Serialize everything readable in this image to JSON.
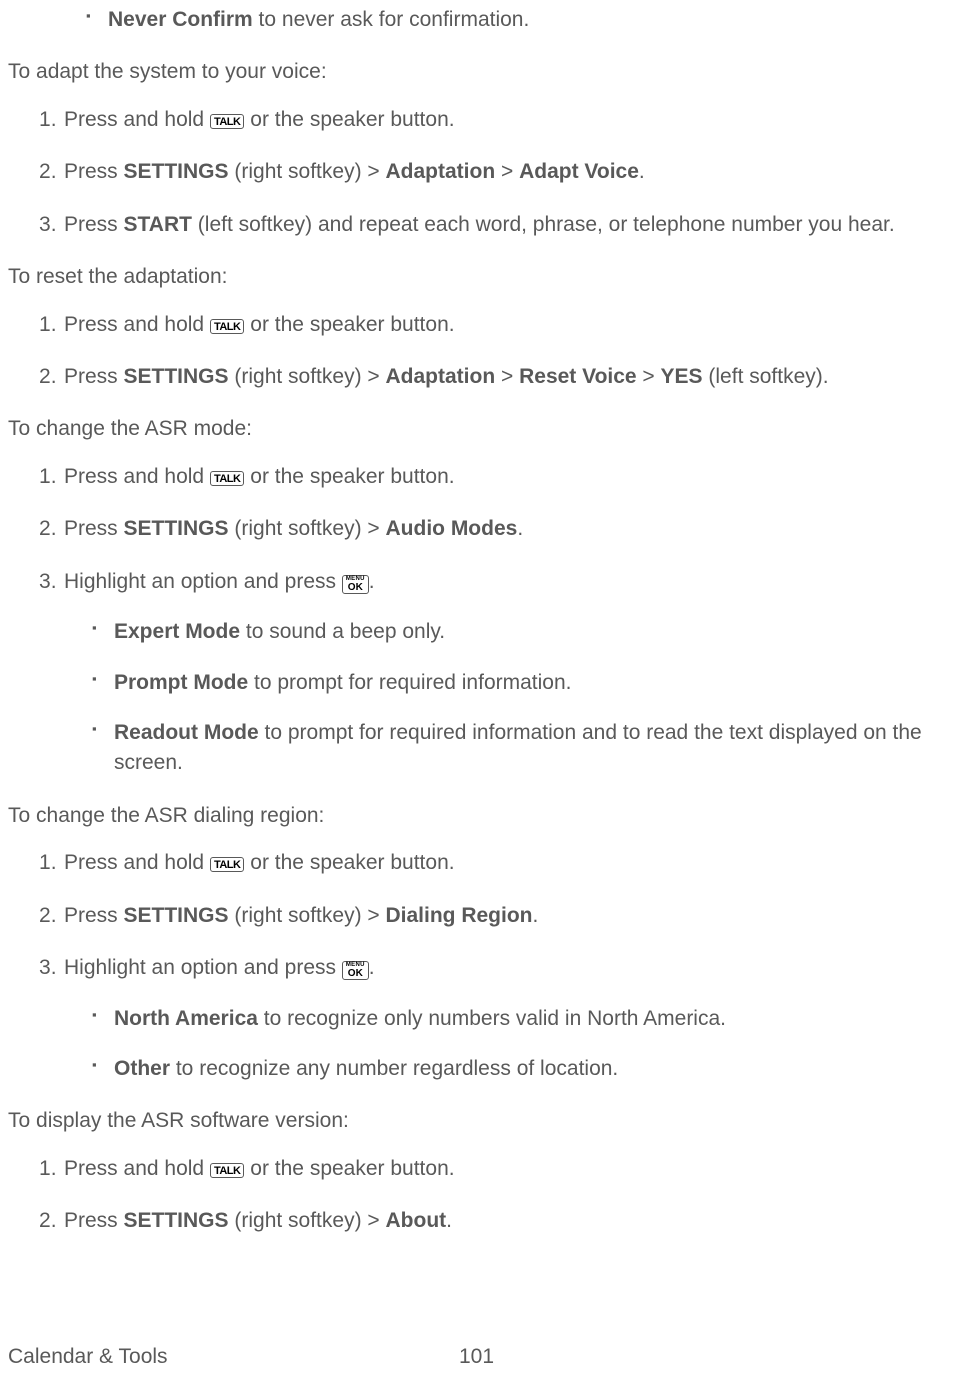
{
  "top_bullet": {
    "bold": "Never Confirm",
    "rest": " to never ask for confirmation."
  },
  "sections": [
    {
      "intro": "To adapt the system to your voice:",
      "steps": [
        {
          "prefix": "Press and hold ",
          "key": "TALK",
          "suffix": " or the speaker button."
        },
        {
          "parts": [
            {
              "t": "Press "
            },
            {
              "b": "SETTINGS"
            },
            {
              "t": " (right softkey) > "
            },
            {
              "b": "Adaptation"
            },
            {
              "t": " > "
            },
            {
              "b": "Adapt Voice"
            },
            {
              "t": "."
            }
          ]
        },
        {
          "parts": [
            {
              "t": "Press "
            },
            {
              "b": "START"
            },
            {
              "t": " (left softkey) and repeat each word, phrase, or telephone number you hear."
            }
          ]
        }
      ]
    },
    {
      "intro": "To reset the adaptation:",
      "steps": [
        {
          "prefix": "Press and hold ",
          "key": "TALK",
          "suffix": " or the speaker button."
        },
        {
          "parts": [
            {
              "t": "Press "
            },
            {
              "b": "SETTINGS"
            },
            {
              "t": " (right softkey) > "
            },
            {
              "b": "Adaptation"
            },
            {
              "t": " > "
            },
            {
              "b": "Reset Voice"
            },
            {
              "t": " > "
            },
            {
              "b": "YES"
            },
            {
              "t": " (left softkey)."
            }
          ]
        }
      ]
    },
    {
      "intro": "To change the ASR mode:",
      "steps": [
        {
          "prefix": "Press and hold ",
          "key": "TALK",
          "suffix": " or the speaker button."
        },
        {
          "parts": [
            {
              "t": "Press "
            },
            {
              "b": "SETTINGS"
            },
            {
              "t": " (right softkey) > "
            },
            {
              "b": "Audio Modes"
            },
            {
              "t": "."
            }
          ]
        },
        {
          "prefix": "Highlight an option and press ",
          "key": "OK",
          "suffix": ".",
          "sub": [
            {
              "bold": "Expert Mode",
              "rest": " to sound a beep only."
            },
            {
              "bold": "Prompt Mode",
              "rest": " to prompt for required information."
            },
            {
              "bold": "Readout Mode",
              "rest": " to prompt for required information and to read the text displayed on the screen."
            }
          ]
        }
      ]
    },
    {
      "intro": "To change the ASR dialing region:",
      "steps": [
        {
          "prefix": "Press and hold ",
          "key": "TALK",
          "suffix": " or the speaker button."
        },
        {
          "parts": [
            {
              "t": "Press "
            },
            {
              "b": "SETTINGS"
            },
            {
              "t": " (right softkey) > "
            },
            {
              "b": "Dialing Region"
            },
            {
              "t": "."
            }
          ]
        },
        {
          "prefix": "Highlight an option and press ",
          "key": "OK",
          "suffix": ".",
          "sub": [
            {
              "bold": "North America",
              "rest": " to recognize only numbers valid in North America."
            },
            {
              "bold": "Other",
              "rest": " to recognize any number regardless of location."
            }
          ]
        }
      ]
    },
    {
      "intro": "To display the ASR software version:",
      "steps": [
        {
          "prefix": "Press and hold ",
          "key": "TALK",
          "suffix": " or the speaker button."
        },
        {
          "parts": [
            {
              "t": "Press "
            },
            {
              "b": "SETTINGS"
            },
            {
              "t": " (right softkey) > "
            },
            {
              "b": "About"
            },
            {
              "t": "."
            }
          ]
        }
      ]
    }
  ],
  "footer": {
    "section": "Calendar & Tools",
    "page": "101"
  },
  "keys": {
    "talk": "TALK",
    "menu": "MENU",
    "ok": "OK"
  }
}
